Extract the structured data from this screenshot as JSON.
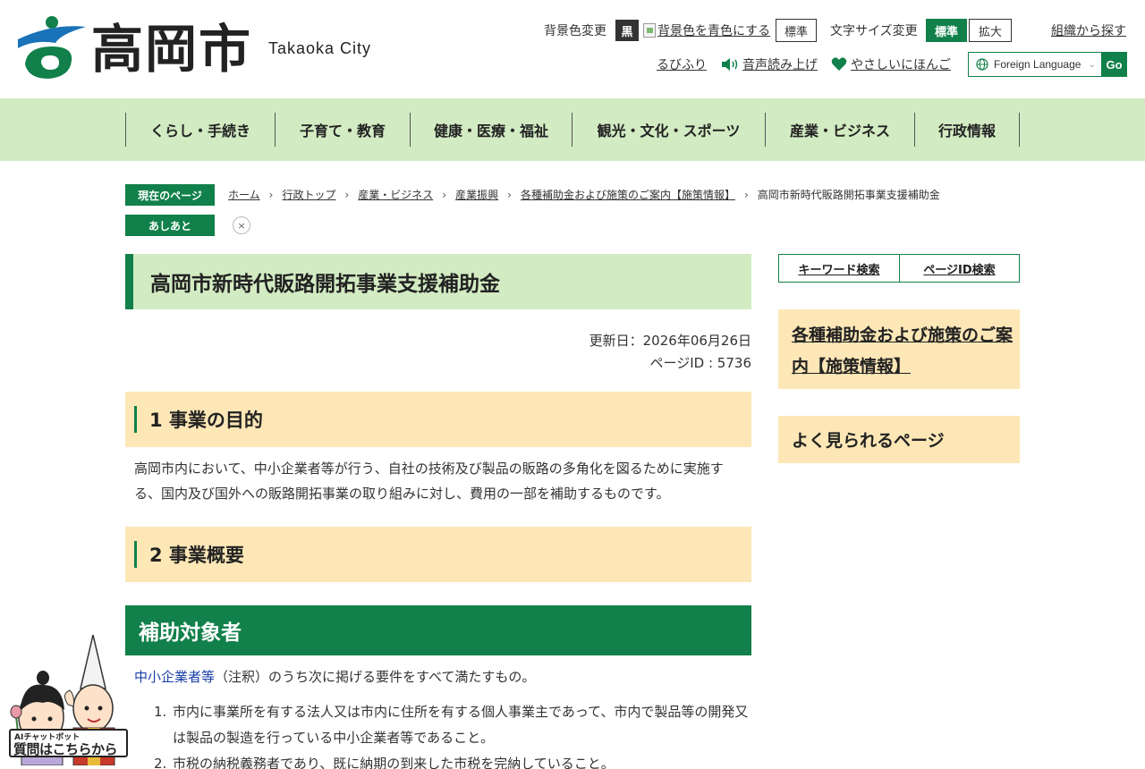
{
  "header": {
    "logo_kanji": "高岡市",
    "logo_en": "Takaoka City",
    "bg_color_label": "背景色変更",
    "bg_black_label": "黒",
    "bg_blue_label": "背景色を青色にする",
    "bg_standard_label": "標準",
    "font_size_label": "文字サイズ変更",
    "font_standard_label": "標準",
    "font_large_label": "拡大",
    "org_search_link": "組織から探す",
    "ruby_link": "るびふり",
    "voice_link": "音声読み上げ",
    "easy_japanese_link": "やさしいにほんご",
    "language_select": "Foreign Language",
    "go_label": "Go"
  },
  "gnav": {
    "items": [
      {
        "label": "くらし・手続き"
      },
      {
        "label": "子育て・教育"
      },
      {
        "label": "健康・医療・福祉"
      },
      {
        "label": "観光・文化・スポーツ"
      },
      {
        "label": "産業・ビジネス"
      },
      {
        "label": "行政情報"
      }
    ]
  },
  "breadcrumb": {
    "current_label": "現在のページ",
    "items": [
      "ホーム",
      "行政トップ",
      "産業・ビジネス",
      "産業振興",
      "各種補助金および施策のご案内【施策情報】",
      "高岡市新時代販路開拓事業支援補助金"
    ],
    "history_label": "あしあと",
    "close_icon": "×"
  },
  "main": {
    "title": "高岡市新時代販路開拓事業支援補助金",
    "updated": "更新日：2026年06月26日",
    "page_id": "ページID : 5736",
    "section1_heading": "1 事業の目的",
    "section1_text": "高岡市内において、中小企業者等が行う、自社の技術及び製品の販路の多角化を図るために実施する、国内及び国外への販路開拓事業の取り組みに対し、費用の一部を補助するものです。",
    "section2_heading": "2 事業概要",
    "target_heading": "補助対象者",
    "target_term": "中小企業者等",
    "target_rest": "（注釈）のうち次に掲げる要件をすべて満たすもの。",
    "list": [
      {
        "num": "1.",
        "text": "市内に事業所を有する法人又は市内に住所を有する個人事業主であって、市内で製品等の開発又は製品の製造を行っている中小企業者等であること。"
      },
      {
        "num": "2.",
        "text": "市税の納税義務者であり、既に納期の到来した市税を完納していること。"
      }
    ]
  },
  "sidebar": {
    "keyword_search": "キーワード検索",
    "pageid_search": "ページID検索",
    "related_link": "各種補助金および施策のご案内【施策情報】",
    "popular_heading": "よく見られるページ"
  },
  "chatbot": {
    "small_label": "AIチャットボット",
    "big_label": "質問はこちらから"
  },
  "colors": {
    "brand_green": "#11804a",
    "nav_bg": "#d2ebc2",
    "section_bg": "#fde7b6",
    "term_blue": "#1a3fa8"
  }
}
